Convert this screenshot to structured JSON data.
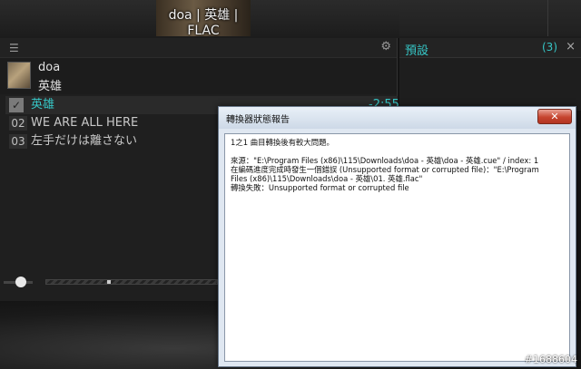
{
  "now_playing": {
    "title": "doa | 英雄 | FLAC"
  },
  "playlist": {
    "menu_icon": "menu-icon",
    "settings_icon": "gear-icon",
    "album": {
      "artist": "doa",
      "album": "英雄"
    },
    "tracks": [
      {
        "num": "",
        "title": "英雄",
        "duration": "-2:55",
        "current": true
      },
      {
        "num": "02",
        "title": "WE ARE ALL HERE"
      },
      {
        "num": "03",
        "title": "左手だけは離さない"
      }
    ]
  },
  "presets": {
    "label": "預設",
    "count": "(3)",
    "close": "×"
  },
  "dialog": {
    "title": "轉換器狀態報告",
    "close": "✕",
    "lines": [
      "1之1 曲目轉換後有較大問題。",
      "來源：\"E:\\Program Files (x86)\\115\\Downloads\\doa - 英雄\\doa - 英雄.cue\" / index: 1",
      "  在編碼進度完成時發生一個錯誤 (Unsupported format or corrupted file)：\"E:\\Program",
      "Files (x86)\\115\\Downloads\\doa - 英雄\\01. 英雄.flac\"",
      "  轉換失敗：Unsupported format or corrupted file"
    ]
  },
  "watermark": "#1688604"
}
